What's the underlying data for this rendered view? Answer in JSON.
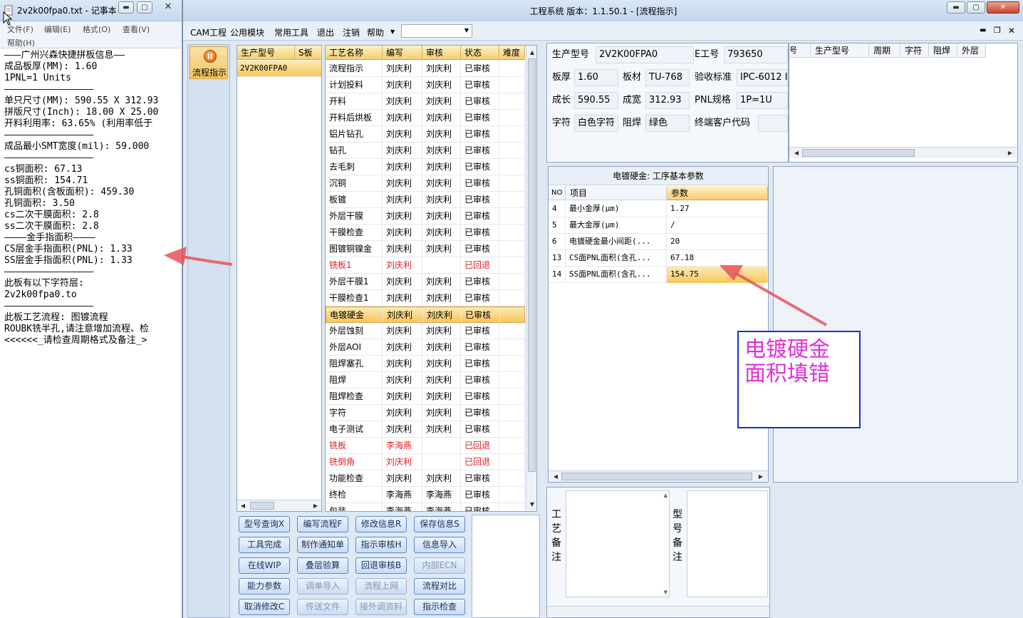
{
  "notepad": {
    "title": "2v2k00fpa0.txt - 记事本",
    "menu": [
      "文件(F)",
      "编辑(E)",
      "格式(O)",
      "查看(V)",
      "帮助(H)"
    ],
    "lines": [
      "———广州兴森快捷拼板信息——",
      "成品板厚(MM): 1.60",
      "1PNL=1 Units",
      "————————————————",
      "单只尺寸(MM): 590.55 X 312.93",
      "拼版尺寸(Inch): 18.00 X 25.00",
      "开料利用率: 63.65% (利用率低于",
      "————————————————",
      "成品最小SMT宽度(mil): 59.000",
      "————————————————",
      "cs铜面积: 67.13",
      "ss铜面积: 154.71",
      "孔铜面积(含板面积): 459.30",
      "孔铜面积: 3.50",
      "cs二次干膜面积: 2.8",
      "ss二次干膜面积: 2.8",
      "————金手指面积————",
      "CS层金手指面积(PNL): 1.33",
      "SS层金手指面积(PNL): 1.33",
      "————————————————",
      "此板有以下字符层:",
      "2v2k00fpa0.to",
      "————————————————",
      "此板工艺流程: 图镀流程",
      "ROUBK铣半孔,请注意增加流程、检",
      "<<<<<<_请检查周期格式及备注_>"
    ]
  },
  "main": {
    "title": "工程系统  版本：1.1.50.1 - [流程指示]",
    "menu": [
      "CAM工程",
      "公用模块",
      "常用工具",
      "退出",
      "注销",
      "帮助"
    ],
    "nav_label": "流程指示",
    "model_panel": {
      "headers": [
        "生产型号",
        "S板"
      ],
      "rows": [
        "2V2K00FPA0"
      ]
    },
    "process_panel": {
      "headers": [
        "工艺名称",
        "编写",
        "审核",
        "状态",
        "难度"
      ],
      "rows": [
        {
          "name": "流程指示",
          "writer": "刘庆利",
          "reviewer": "刘庆利",
          "status": "已审核"
        },
        {
          "name": "计划投料",
          "writer": "刘庆利",
          "reviewer": "刘庆利",
          "status": "已审核"
        },
        {
          "name": "开料",
          "writer": "刘庆利",
          "reviewer": "刘庆利",
          "status": "已审核"
        },
        {
          "name": "开料后烘板",
          "writer": "刘庆利",
          "reviewer": "刘庆利",
          "status": "已审核"
        },
        {
          "name": "铝片钻孔",
          "writer": "刘庆利",
          "reviewer": "刘庆利",
          "status": "已审核"
        },
        {
          "name": "钻孔",
          "writer": "刘庆利",
          "reviewer": "刘庆利",
          "status": "已审核"
        },
        {
          "name": "去毛刺",
          "writer": "刘庆利",
          "reviewer": "刘庆利",
          "status": "已审核"
        },
        {
          "name": "沉铜",
          "writer": "刘庆利",
          "reviewer": "刘庆利",
          "status": "已审核"
        },
        {
          "name": "板镀",
          "writer": "刘庆利",
          "reviewer": "刘庆利",
          "status": "已审核"
        },
        {
          "name": "外层干膜",
          "writer": "刘庆利",
          "reviewer": "刘庆利",
          "status": "已审核"
        },
        {
          "name": "干膜检查",
          "writer": "刘庆利",
          "reviewer": "刘庆利",
          "status": "已审核"
        },
        {
          "name": "图镀铜镍金",
          "writer": "刘庆利",
          "reviewer": "刘庆利",
          "status": "已审核"
        },
        {
          "name": "铣板1",
          "writer": "刘庆利",
          "reviewer": "",
          "status": "已回退",
          "red": true
        },
        {
          "name": "外层干膜1",
          "writer": "刘庆利",
          "reviewer": "刘庆利",
          "status": "已审核"
        },
        {
          "name": "干膜检查1",
          "writer": "刘庆利",
          "reviewer": "刘庆利",
          "status": "已审核"
        },
        {
          "name": "电镀硬金",
          "writer": "刘庆利",
          "reviewer": "刘庆利",
          "status": "已审核",
          "selected": true
        },
        {
          "name": "外层蚀刻",
          "writer": "刘庆利",
          "reviewer": "刘庆利",
          "status": "已审核"
        },
        {
          "name": "外层AOI",
          "writer": "刘庆利",
          "reviewer": "刘庆利",
          "status": "已审核"
        },
        {
          "name": "阻焊塞孔",
          "writer": "刘庆利",
          "reviewer": "刘庆利",
          "status": "已审核"
        },
        {
          "name": "阻焊",
          "writer": "刘庆利",
          "reviewer": "刘庆利",
          "status": "已审核"
        },
        {
          "name": "阻焊检查",
          "writer": "刘庆利",
          "reviewer": "刘庆利",
          "status": "已审核"
        },
        {
          "name": "字符",
          "writer": "刘庆利",
          "reviewer": "刘庆利",
          "status": "已审核"
        },
        {
          "name": "电子测试",
          "writer": "刘庆利",
          "reviewer": "刘庆利",
          "status": "已审核"
        },
        {
          "name": "铣板",
          "writer": "李海燕",
          "reviewer": "",
          "status": "已回退",
          "red": true
        },
        {
          "name": "铣倒角",
          "writer": "刘庆利",
          "reviewer": "",
          "status": "已回退",
          "red": true
        },
        {
          "name": "功能检查",
          "writer": "刘庆利",
          "reviewer": "刘庆利",
          "status": "已审核"
        },
        {
          "name": "终检",
          "writer": "李海燕",
          "reviewer": "李海燕",
          "status": "已审核"
        },
        {
          "name": "包装",
          "writer": "李海燕",
          "reviewer": "李海燕",
          "status": "已审核"
        }
      ]
    },
    "buttons": [
      {
        "label": "型号查询X",
        "disabled": false
      },
      {
        "label": "编写流程F",
        "disabled": false
      },
      {
        "label": "修改信息R",
        "disabled": false
      },
      {
        "label": "保存信息S",
        "disabled": false
      },
      {
        "label": "工具完成",
        "disabled": false
      },
      {
        "label": "制作通知单",
        "disabled": false
      },
      {
        "label": "指示审核H",
        "disabled": false
      },
      {
        "label": "信息导入",
        "disabled": false
      },
      {
        "label": "在线WIP",
        "disabled": false
      },
      {
        "label": "叠层验算",
        "disabled": false
      },
      {
        "label": "回退审核B",
        "disabled": false
      },
      {
        "label": "内部ECN",
        "disabled": true
      },
      {
        "label": "能力参数",
        "disabled": false
      },
      {
        "label": "调单导入",
        "disabled": true
      },
      {
        "label": "流程上网",
        "disabled": true
      },
      {
        "label": "流程对比",
        "disabled": false
      },
      {
        "label": "取消修改C",
        "disabled": false
      },
      {
        "label": "传送文件",
        "disabled": true
      },
      {
        "label": "接外调资料",
        "disabled": true
      },
      {
        "label": "指示检查",
        "disabled": false
      }
    ],
    "info": {
      "model_label": "生产型号",
      "model_value": "2V2K00FPA0",
      "e_label": "E工号",
      "e_value": "793650",
      "thick_label": "板厚",
      "thick_value": "1.60",
      "material_label": "板材",
      "material_value": "TU-768",
      "std_label": "验收标准",
      "std_value": "IPC-6012 I",
      "len_label": "成长",
      "len_value": "590.55",
      "wid_label": "成宽",
      "wid_value": "312.93",
      "pnl_label": "PNL规格",
      "pnl_value": "1P=1U",
      "char_label": "字符",
      "char_value": "白色字符",
      "mask_label": "阻焊",
      "mask_value": "绿色",
      "cust_label": "终端客户代码",
      "cust_value": ""
    },
    "right_table": {
      "headers": [
        "号",
        "生产型号",
        "周期",
        "字符",
        "阻焊",
        "外层"
      ]
    },
    "param_panel": {
      "title": "电镀硬金: 工序基本参数",
      "headers": [
        "NO",
        "项目",
        "参数"
      ],
      "rows": [
        {
          "no": "4",
          "item": "最小金厚(μm)",
          "value": "1.27"
        },
        {
          "no": "5",
          "item": "最大金厚(μm)",
          "value": "/"
        },
        {
          "no": "6",
          "item": "电镀硬金最小间距(...",
          "value": "20"
        },
        {
          "no": "13",
          "item": "CS面PNL面积(含孔...",
          "value": "67.18"
        },
        {
          "no": "14",
          "item": "SS面PNL面积(含孔...",
          "value": "154.75",
          "selected": true
        }
      ]
    },
    "remarks": {
      "process_label": "工艺备注",
      "model_label": "型号备注"
    }
  },
  "annotation": {
    "text_line1": "电镀硬金",
    "text_line2": "面积填错",
    "color": "#e030d8",
    "arrow_color": "#e8525a"
  }
}
